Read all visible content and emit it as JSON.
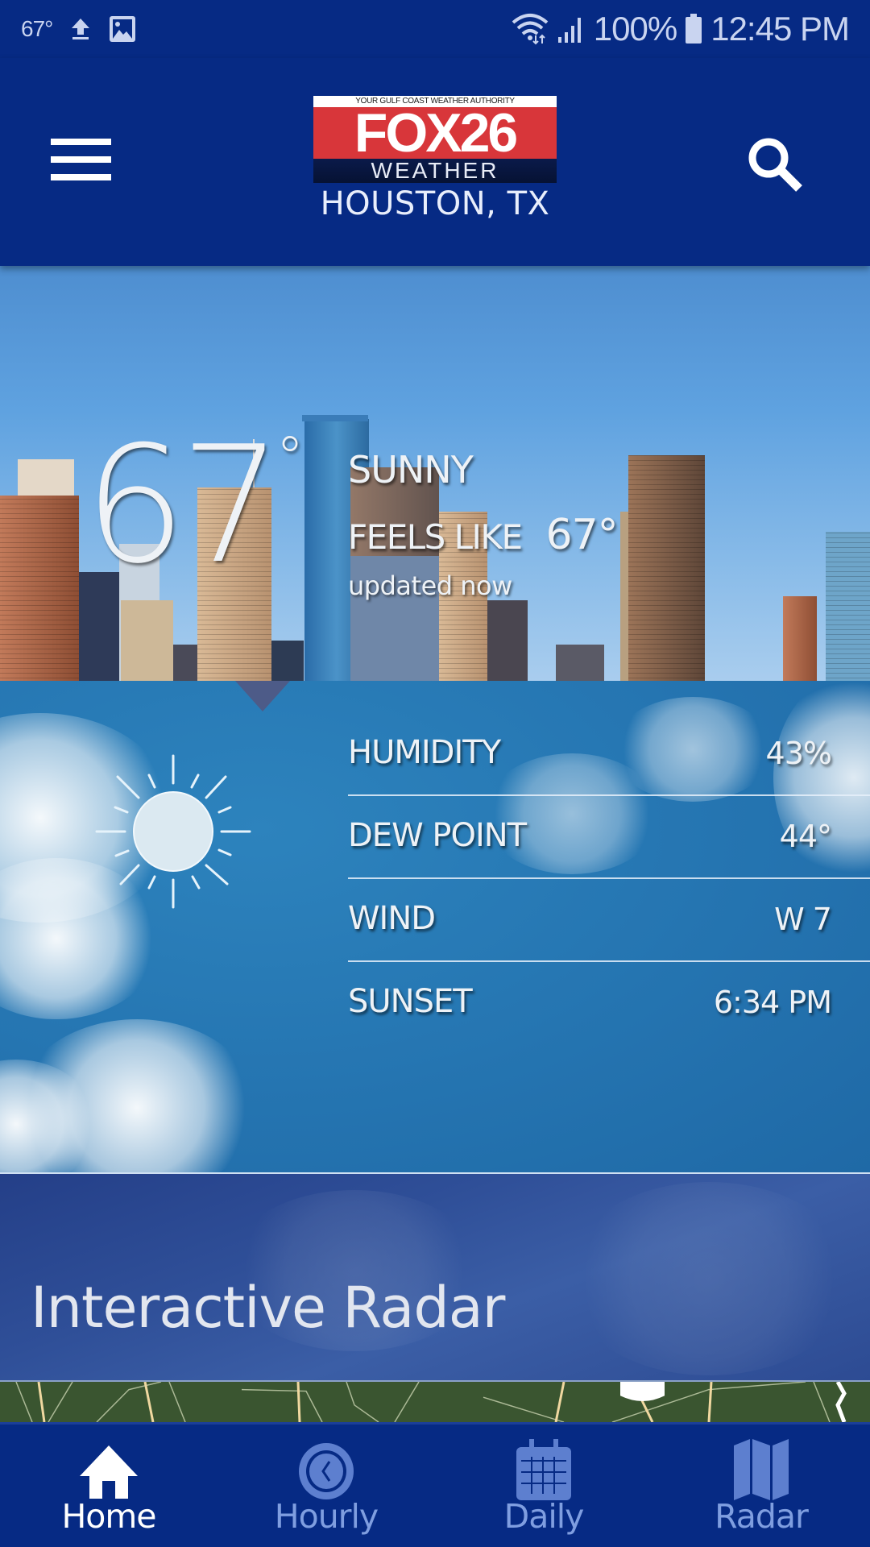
{
  "status_bar": {
    "temperature": "67°",
    "battery": "100%",
    "time": "12:45 PM",
    "icons": [
      "upload-icon",
      "image-icon",
      "wifi-icon",
      "signal-icon",
      "battery-icon"
    ]
  },
  "header": {
    "logo": {
      "tagline": "YOUR GULF COAST WEATHER AUTHORITY",
      "brand": "FOX26",
      "sub": "WEATHER"
    },
    "location": "HOUSTON, TX",
    "menu_icon": "hamburger-menu-icon",
    "search_icon": "search-icon"
  },
  "current": {
    "temperature": "67",
    "degree_symbol": "°",
    "condition": "SUNNY",
    "feels_like_label": "FEELS LIKE",
    "feels_like_value": "67°",
    "updated": "updated now",
    "condition_icon": "sun-icon"
  },
  "details": [
    {
      "label": "HUMIDITY",
      "value": "43%"
    },
    {
      "label": "DEW POINT",
      "value": "44°"
    },
    {
      "label": "WIND",
      "value": "W 7"
    },
    {
      "label": "SUNSET",
      "value": "6:34 PM"
    }
  ],
  "radar_card": {
    "title": "Interactive Radar"
  },
  "bottom_nav": {
    "active": "Home",
    "items": [
      {
        "label": "Home",
        "icon": "home-icon"
      },
      {
        "label": "Hourly",
        "icon": "clock-icon"
      },
      {
        "label": "Daily",
        "icon": "calendar-icon"
      },
      {
        "label": "Radar",
        "icon": "map-icon"
      }
    ]
  },
  "colors": {
    "brand_navy": "#062a84",
    "logo_red": "#d8363a",
    "nav_inactive": "#7f9ee0",
    "panel_blue": "#2677b3"
  }
}
